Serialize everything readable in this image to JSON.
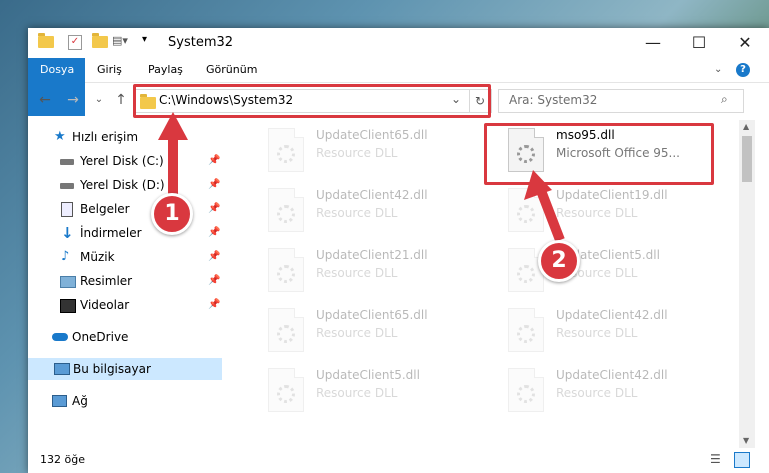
{
  "window": {
    "title": "System32",
    "controls": {
      "minimize": "—",
      "maximize": "☐",
      "close": "✕"
    }
  },
  "ribbon": {
    "tabs": [
      "Dosya",
      "Giriş",
      "Paylaş",
      "Görünüm"
    ],
    "help": "?"
  },
  "navigation": {
    "back": "←",
    "forward": "→",
    "recent": "⌄",
    "up": "↑",
    "address": "C:\\Windows\\System32",
    "search_placeholder": "Ara: System32"
  },
  "sidebar": {
    "items": [
      {
        "label": "Hızlı erişim",
        "icon": "star-icon",
        "pinned": false
      },
      {
        "label": "Yerel Disk (C:)",
        "icon": "drive-icon",
        "pinned": true
      },
      {
        "label": "Yerel Disk (D:)",
        "icon": "drive-icon",
        "pinned": true
      },
      {
        "label": "Belgeler",
        "icon": "documents-icon",
        "pinned": true
      },
      {
        "label": "İndirmeler",
        "icon": "download-icon",
        "pinned": true
      },
      {
        "label": "Müzik",
        "icon": "music-icon",
        "pinned": true
      },
      {
        "label": "Resimler",
        "icon": "pictures-icon",
        "pinned": true
      },
      {
        "label": "Videolar",
        "icon": "video-icon",
        "pinned": true
      },
      {
        "label": "OneDrive",
        "icon": "cloud-icon",
        "pinned": false
      },
      {
        "label": "Bu bilgisayar",
        "icon": "computer-icon",
        "pinned": false,
        "selected": true
      },
      {
        "label": "Ağ",
        "icon": "network-icon",
        "pinned": false
      }
    ]
  },
  "files": [
    {
      "name": "UpdateClient65.dll",
      "desc": "Resource DLL",
      "faded": true
    },
    {
      "name": "mso95.dll",
      "desc": "Microsoft Office 95...",
      "faded": false
    },
    {
      "name": "UpdateClient42.dll",
      "desc": "Resource DLL",
      "faded": true
    },
    {
      "name": "UpdateClient19.dll",
      "desc": "Resource DLL",
      "faded": true
    },
    {
      "name": "UpdateClient21.dll",
      "desc": "Resource DLL",
      "faded": true
    },
    {
      "name": "UpdateClient5.dll",
      "desc": "Resource DLL",
      "faded": true
    },
    {
      "name": "UpdateClient65.dll",
      "desc": "Resource DLL",
      "faded": true
    },
    {
      "name": "UpdateClient42.dll",
      "desc": "Resource DLL",
      "faded": true
    },
    {
      "name": "UpdateClient5.dll",
      "desc": "Resource DLL",
      "faded": true
    },
    {
      "name": "UpdateClient42.dll",
      "desc": "Resource DLL",
      "faded": true
    }
  ],
  "status": {
    "count": "132 öğe"
  },
  "callouts": [
    "1",
    "2"
  ],
  "colors": {
    "accent": "#1979ca",
    "highlight": "#d9383f",
    "selected": "#cce8ff"
  }
}
